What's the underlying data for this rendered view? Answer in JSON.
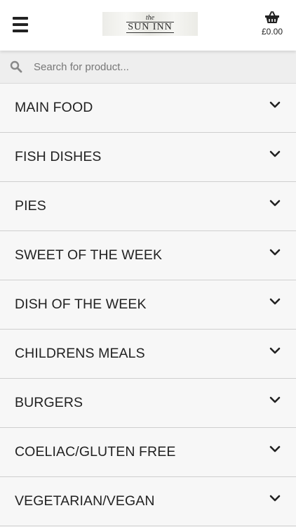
{
  "header": {
    "menu_icon": "hamburger-menu-icon",
    "logo": {
      "small": "the",
      "name": "SUN INN"
    },
    "cart": {
      "icon": "basket-icon",
      "total": "£0.00"
    }
  },
  "search": {
    "icon": "search-icon",
    "placeholder": "Search for product..."
  },
  "categories": [
    {
      "label": "MAIN FOOD"
    },
    {
      "label": "FISH DISHES"
    },
    {
      "label": "PIES"
    },
    {
      "label": "SWEET OF THE WEEK"
    },
    {
      "label": "DISH OF THE WEEK"
    },
    {
      "label": "CHILDRENS MEALS"
    },
    {
      "label": "BURGERS"
    },
    {
      "label": "COELIAC/GLUTEN FREE"
    },
    {
      "label": "VEGETARIAN/VEGAN"
    }
  ],
  "colors": {
    "header_bg": "#ffffff",
    "page_bg": "#f7f7f7",
    "search_bg": "#eeeeee",
    "text": "#222222"
  }
}
